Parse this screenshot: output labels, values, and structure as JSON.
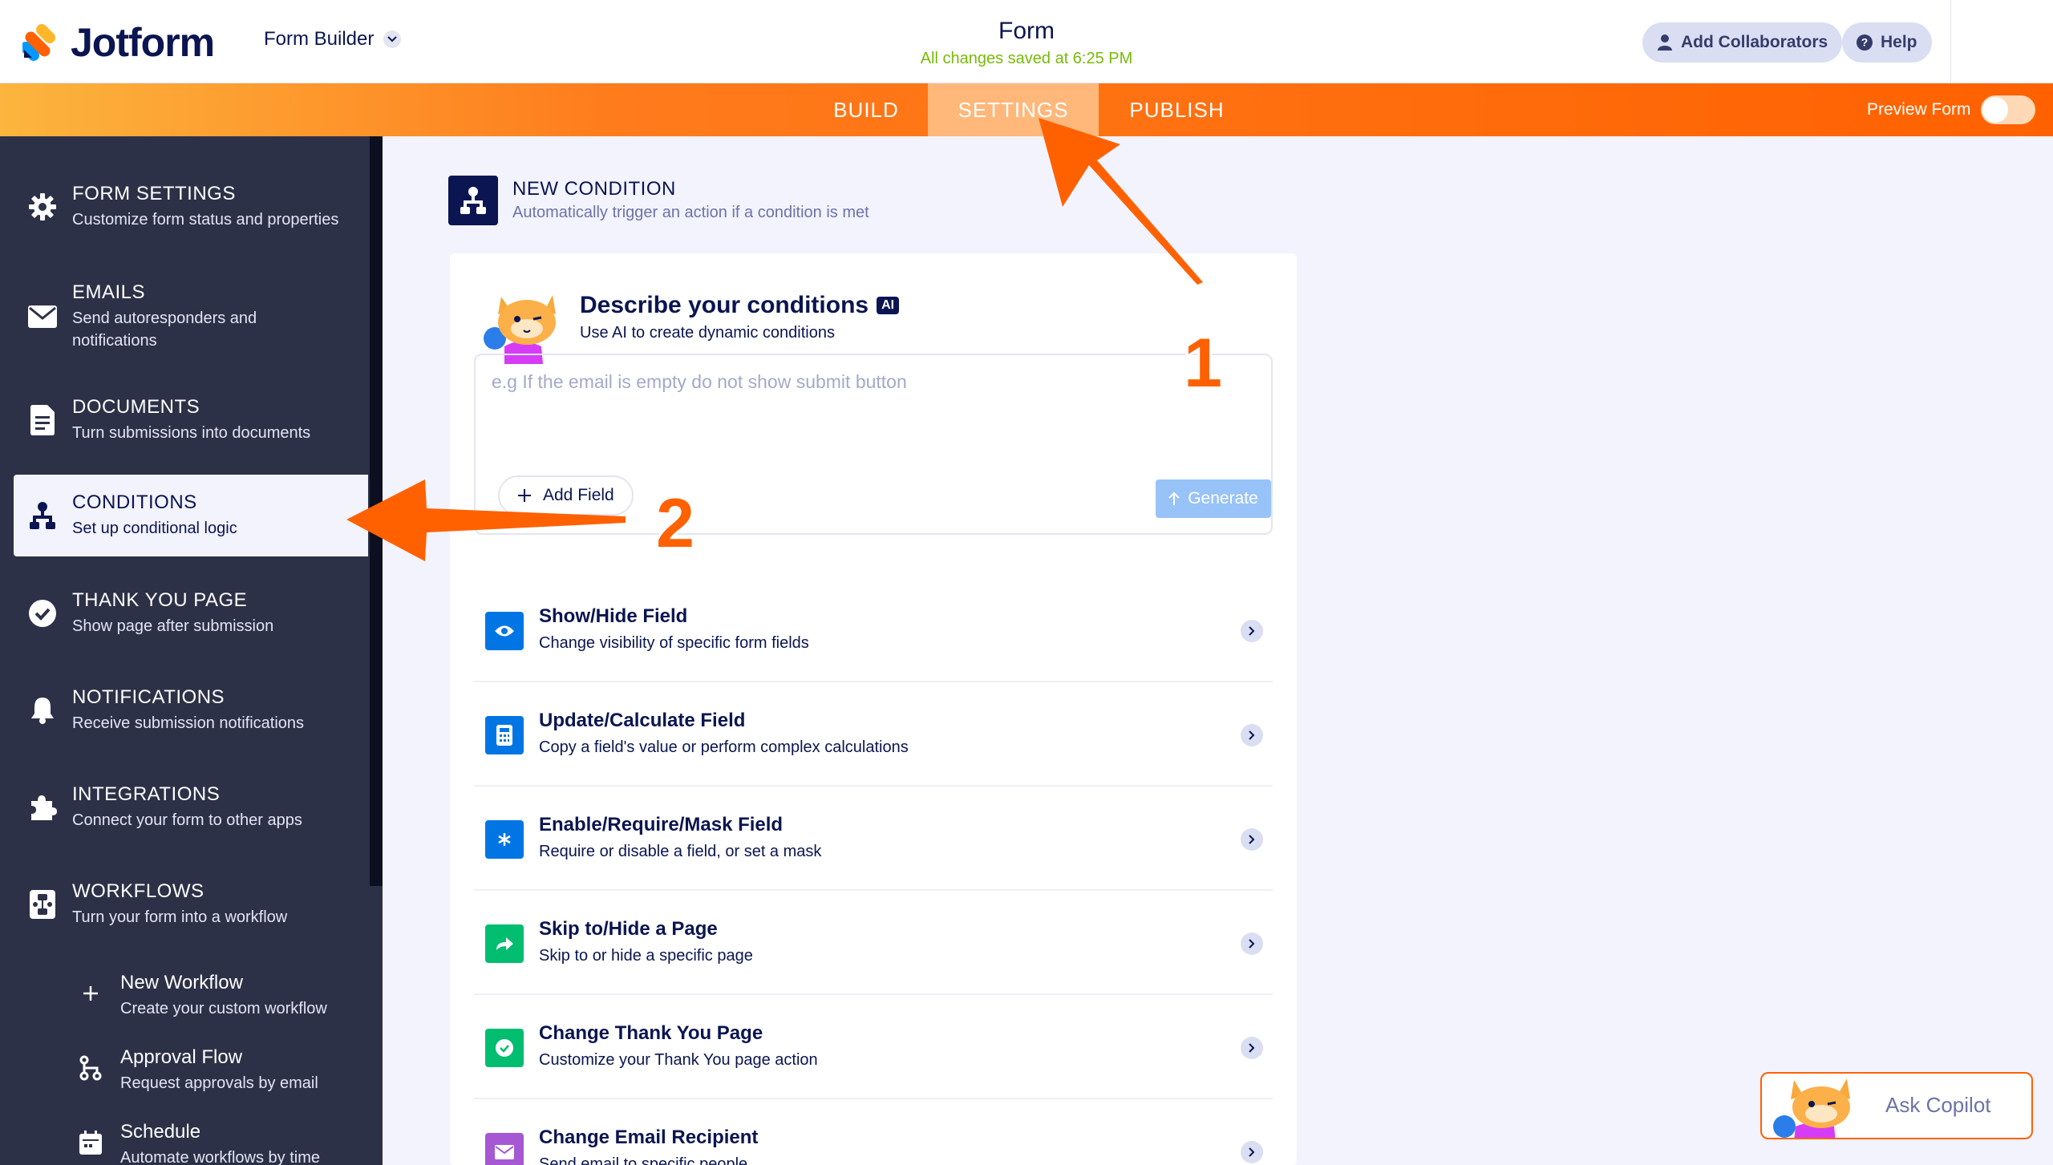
{
  "topbar": {
    "brand": "Jotform",
    "builder_label": "Form Builder",
    "form_title": "Form",
    "save_status": "All changes saved at 6:25 PM",
    "collaborators_label": "Add Collaborators",
    "help_label": "Help"
  },
  "nav": {
    "tabs": [
      {
        "label": "BUILD",
        "active": false
      },
      {
        "label": "SETTINGS",
        "active": true
      },
      {
        "label": "PUBLISH",
        "active": false
      }
    ],
    "preview_label": "Preview Form",
    "preview_on": false
  },
  "sidebar": {
    "items": [
      {
        "title": "FORM SETTINGS",
        "desc": "Customize form status and properties",
        "icon": "gear-icon"
      },
      {
        "title": "EMAILS",
        "desc": "Send autoresponders and notifications",
        "icon": "envelope-icon"
      },
      {
        "title": "DOCUMENTS",
        "desc": "Turn submissions into documents",
        "icon": "document-icon"
      },
      {
        "title": "CONDITIONS",
        "desc": "Set up conditional logic",
        "icon": "conditions-icon",
        "active": true
      },
      {
        "title": "THANK YOU PAGE",
        "desc": "Show page after submission",
        "icon": "check-circle-icon"
      },
      {
        "title": "NOTIFICATIONS",
        "desc": "Receive submission notifications",
        "icon": "bell-icon"
      },
      {
        "title": "INTEGRATIONS",
        "desc": "Connect your form to other apps",
        "icon": "puzzle-icon"
      },
      {
        "title": "WORKFLOWS",
        "desc": "Turn your form into a workflow",
        "icon": "workflow-icon"
      }
    ],
    "sub_items": [
      {
        "title": "New Workflow",
        "desc": "Create your custom workflow",
        "icon": "plus-icon"
      },
      {
        "title": "Approval Flow",
        "desc": "Request approvals by email",
        "icon": "approval-flow-icon"
      },
      {
        "title": "Schedule",
        "desc": "Automate workflows by time",
        "icon": "calendar-icon"
      }
    ]
  },
  "main": {
    "header_title": "NEW CONDITION",
    "header_sub": "Automatically trigger an action if a condition is met",
    "ai": {
      "title": "Describe your conditions",
      "badge": "AI",
      "subtitle": "Use AI to create dynamic conditions",
      "placeholder": "e.g If the email is empty do not show submit button",
      "add_field_label": "Add Field",
      "generate_label": "Generate"
    },
    "actions": [
      {
        "title": "Show/Hide Field",
        "desc": "Change visibility of specific form fields",
        "color": "#0075e3",
        "icon": "eye-icon"
      },
      {
        "title": "Update/Calculate Field",
        "desc": "Copy a field's value or perform complex calculations",
        "color": "#0075e3",
        "icon": "calculator-icon"
      },
      {
        "title": "Enable/Require/Mask Field",
        "desc": "Require or disable a field, or set a mask",
        "color": "#0075e3",
        "icon": "asterisk-icon"
      },
      {
        "title": "Skip to/Hide a Page",
        "desc": "Skip to or hide a specific page",
        "color": "#01bd6f",
        "icon": "skip-arrow-icon"
      },
      {
        "title": "Change Thank You Page",
        "desc": "Customize your Thank You page action",
        "color": "#01bd6f",
        "icon": "check-badge-icon"
      },
      {
        "title": "Change Email Recipient",
        "desc": "Send email to specific people",
        "color": "#a557d4",
        "icon": "envelope-icon"
      }
    ]
  },
  "copilot": {
    "label": "Ask Copilot"
  },
  "annotations": {
    "step1": "1",
    "step2": "2"
  },
  "colors": {
    "accent": "#ff6100",
    "navy": "#0a1551",
    "sidebar": "#2d3147",
    "saved": "#78bb07"
  }
}
